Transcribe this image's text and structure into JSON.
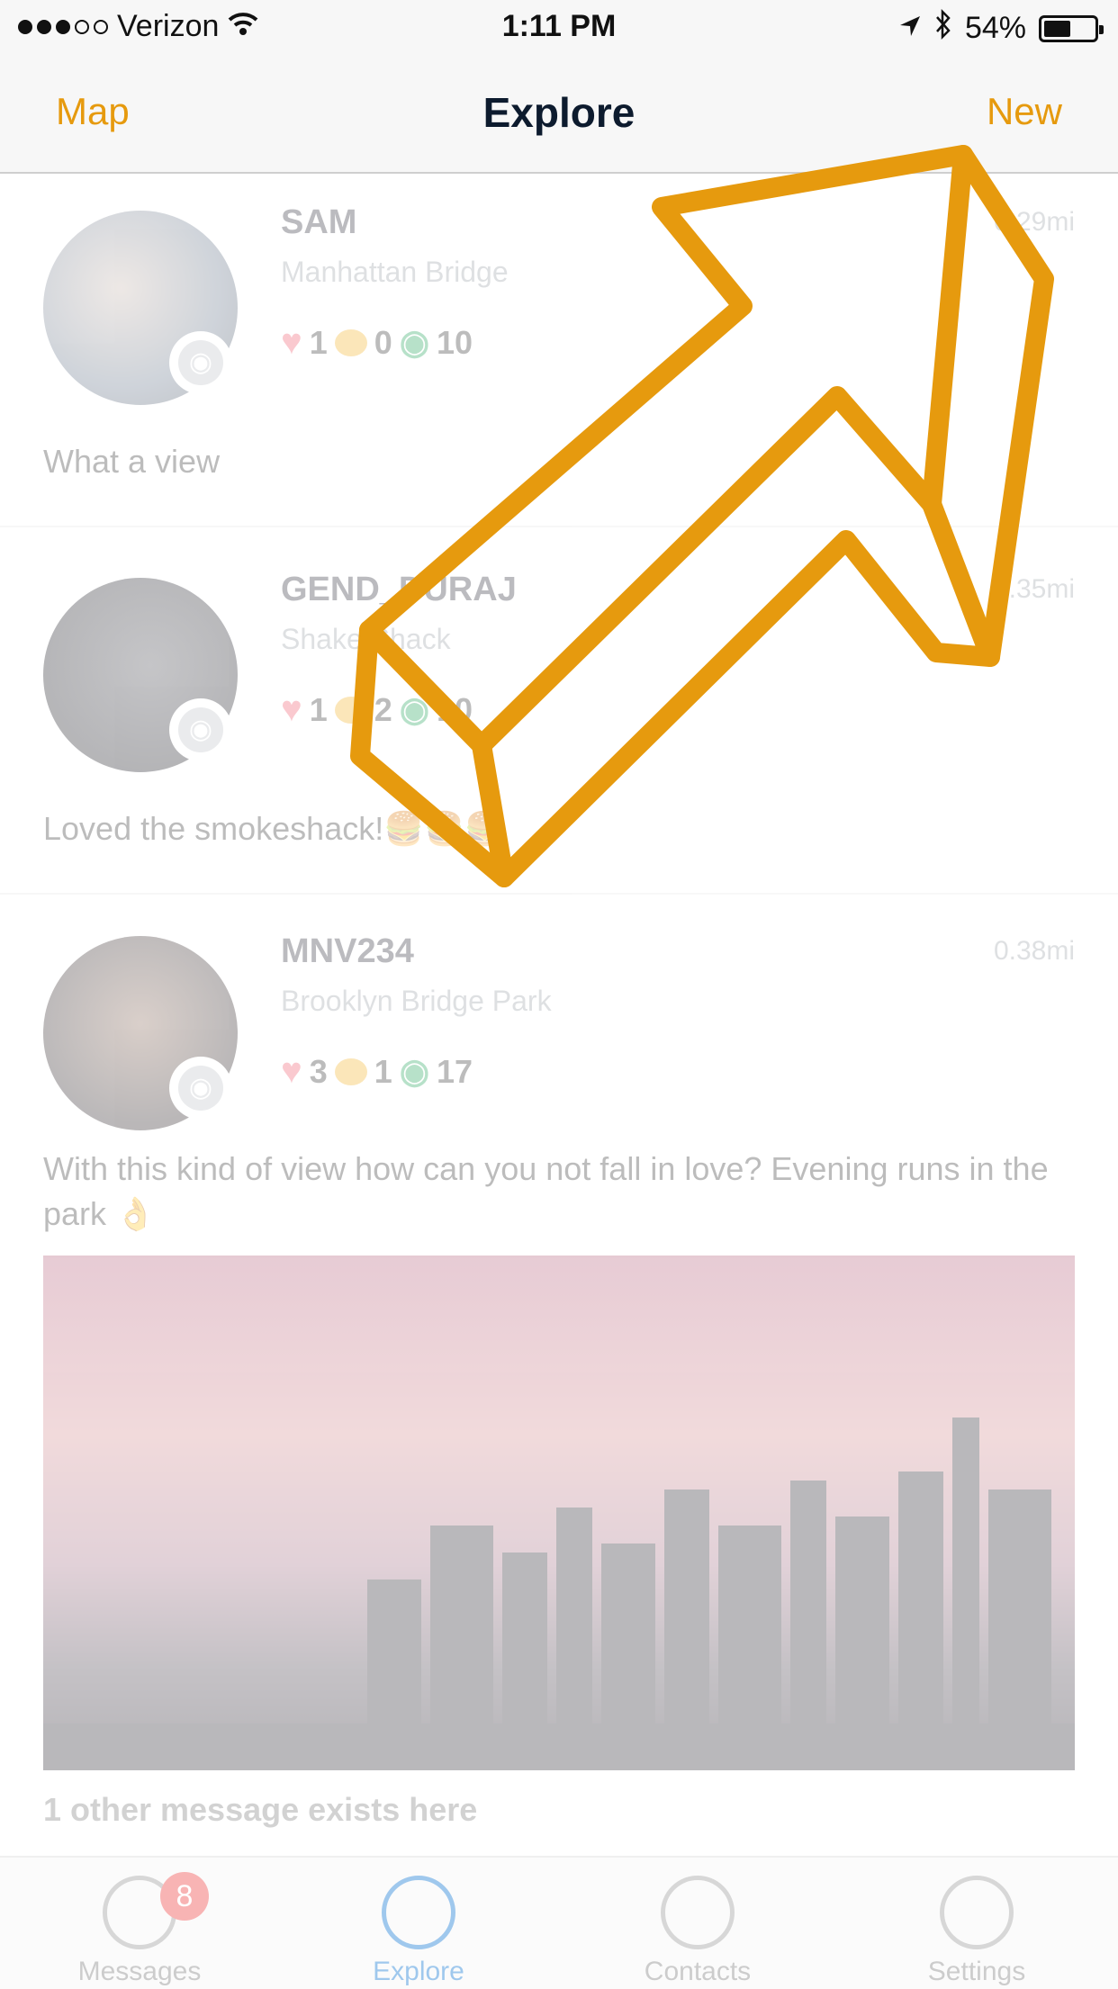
{
  "status_bar": {
    "carrier": "Verizon",
    "time": "1:11 PM",
    "battery": "54%",
    "battery_level": 0.54
  },
  "nav": {
    "left": "Map",
    "title": "Explore",
    "right": "New"
  },
  "posts": [
    {
      "username": "SAM",
      "location": "Manhattan Bridge",
      "distance": "0.29mi",
      "likes": "1",
      "comments": "0",
      "views": "10",
      "text": "What a view"
    },
    {
      "username": "GEND_DURAJ",
      "location": "Shake Shack",
      "distance": "0.35mi",
      "likes": "1",
      "comments": "2",
      "views": "10",
      "text": "Loved the smokeshack!🍔🍔🍔"
    },
    {
      "username": "MNV234",
      "location": "Brooklyn Bridge Park",
      "distance": "0.38mi",
      "likes": "3",
      "comments": "1",
      "views": "17",
      "text": "With this kind of view how can you not fall in love? Evening runs in the park 👌",
      "footer": "1 other message exists here"
    }
  ],
  "tabs": [
    {
      "label": "Messages",
      "badge": "8",
      "icon": "messages-icon"
    },
    {
      "label": "Explore",
      "icon": "compass-icon",
      "active": true
    },
    {
      "label": "Contacts",
      "icon": "contacts-icon"
    },
    {
      "label": "Settings",
      "icon": "gear-icon"
    }
  ],
  "colors": {
    "accent": "#E69A0E",
    "title": "#0d1b2e",
    "active_tab": "#2d86d8",
    "heart": "#f05a6b",
    "bubble": "#f3b32a",
    "eye": "#21a35a"
  }
}
